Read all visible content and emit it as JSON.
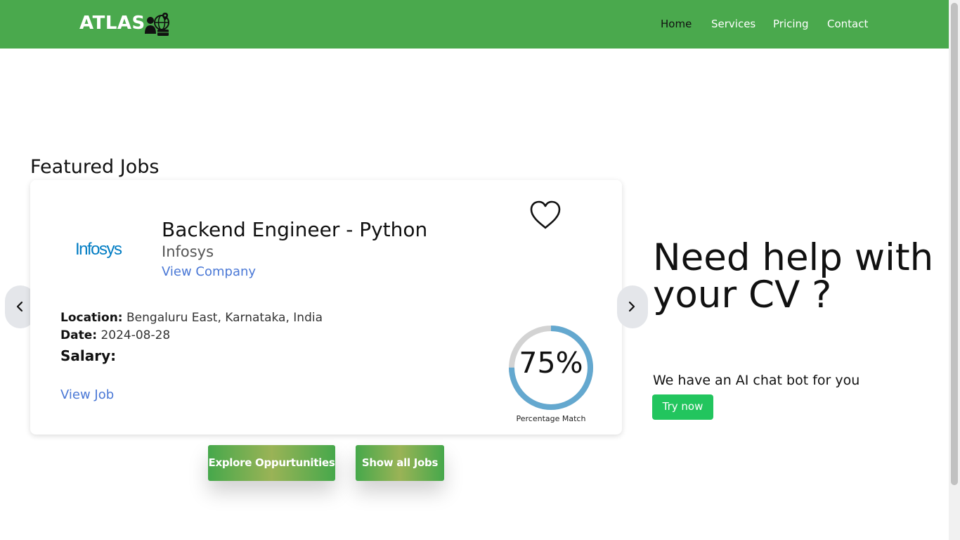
{
  "header": {
    "brand": "ATLAS",
    "nav": [
      "Home",
      "Services",
      "Pricing",
      "Contact"
    ],
    "active": "Home"
  },
  "featured": {
    "title": "Featured Jobs",
    "job": {
      "title": "Backend Engineer - Python",
      "company": "Infosys",
      "company_logo_text": "Infosys",
      "view_company": "View Company",
      "location_label": "Location:",
      "location": "Bengaluru East, Karnataka, India",
      "date_label": "Date:",
      "date": "2024-08-28",
      "salary_label": "Salary:",
      "view_job": "View Job",
      "match_percent": 75,
      "match_label": "75%",
      "match_caption": "Percentage Match"
    },
    "buttons": {
      "explore": "Explore Oppurtunities",
      "show_all": "Show all Jobs"
    }
  },
  "promo": {
    "heading": "Need help with your CV ?",
    "text": "We have an AI chat bot for you",
    "button": "Try now"
  },
  "colors": {
    "header_bg": "#4aa94d",
    "link": "#4a78d6",
    "ring_fill": "#64a8cf",
    "ring_track": "#d3d3d3",
    "try_button": "#22c55e",
    "infosys_blue": "#007cc3"
  },
  "icons": [
    "brand-logo-icon",
    "heart-icon",
    "chevron-left-icon",
    "chevron-right-icon"
  ]
}
